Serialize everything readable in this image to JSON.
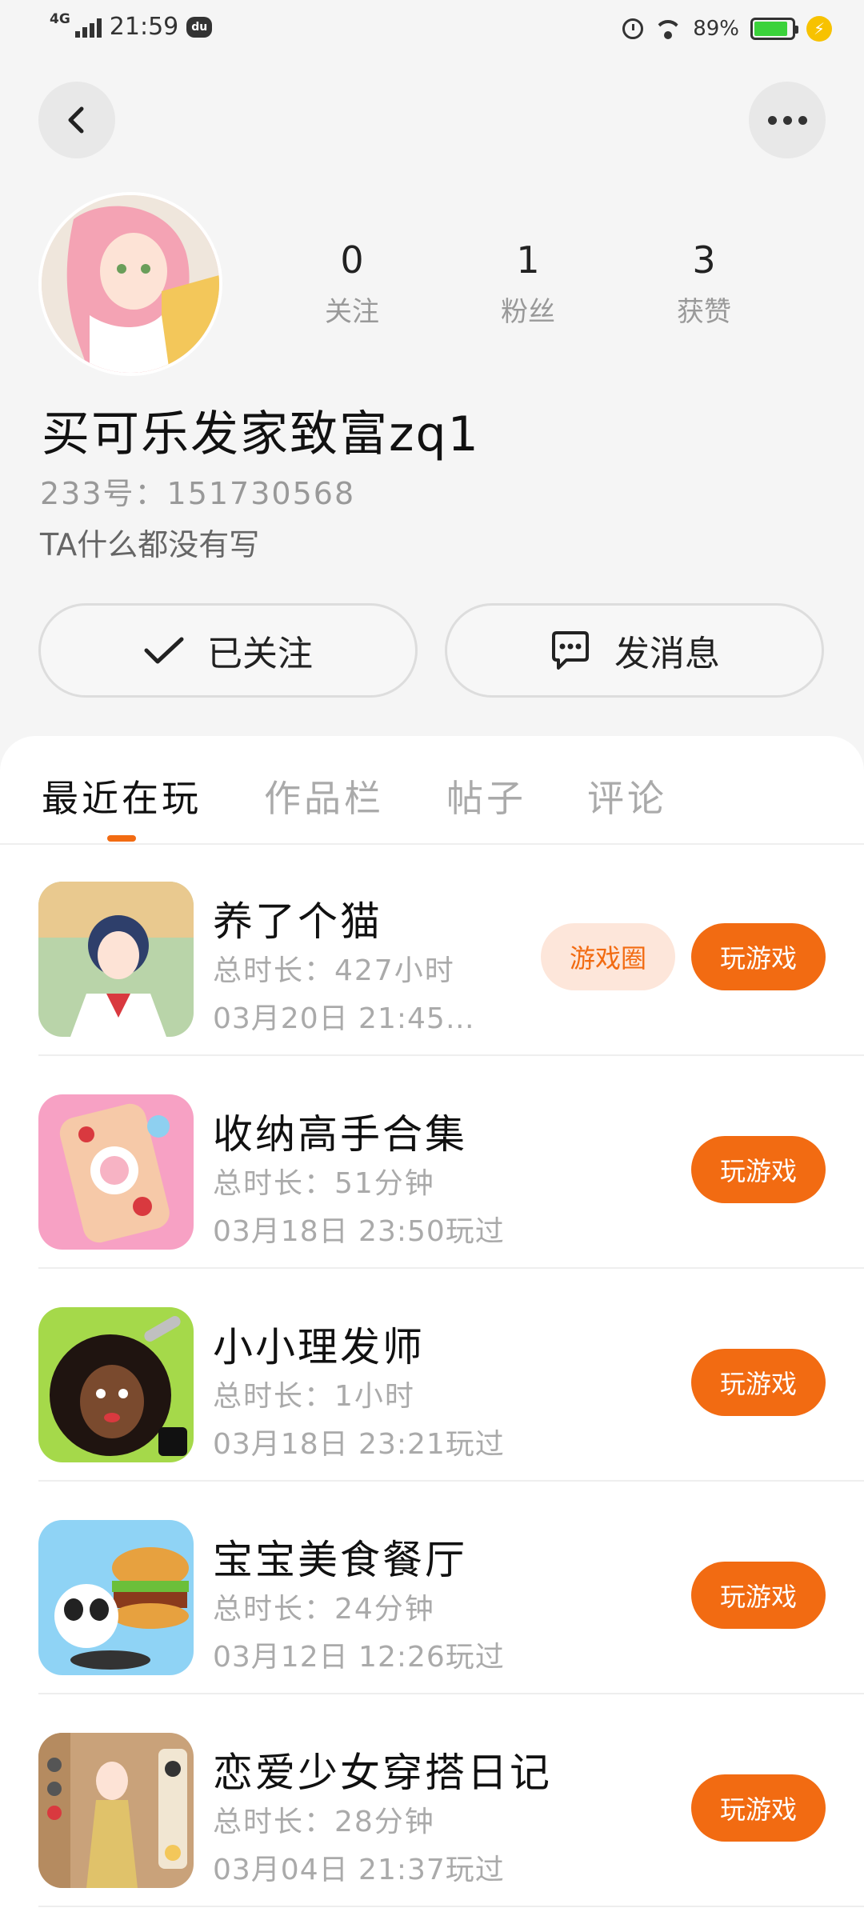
{
  "status_bar": {
    "network": "4G",
    "time": "21:59",
    "app_icon": "du",
    "battery_percent": "89%",
    "battery_level": 0.89,
    "icons": [
      "signal-icon",
      "alarm-icon",
      "wifi-icon",
      "battery-icon",
      "charging-icon"
    ]
  },
  "nav": {
    "back_icon": "chevron-left-icon",
    "more_icon": "more-dots-icon"
  },
  "profile": {
    "stats": [
      {
        "value": "0",
        "label": "关注"
      },
      {
        "value": "1",
        "label": "粉丝"
      },
      {
        "value": "3",
        "label": "获赞"
      }
    ],
    "username": "买可乐发家致富zq1",
    "uid_line": "233号：151730568",
    "bio": "TA什么都没有写"
  },
  "actions": {
    "follow_label": "已关注",
    "message_label": "发消息"
  },
  "tabs": [
    {
      "label": "最近在玩",
      "active": true
    },
    {
      "label": "作品栏",
      "active": false
    },
    {
      "label": "帖子",
      "active": false
    },
    {
      "label": "评论",
      "active": false
    }
  ],
  "accent_color": "#f26b12",
  "games": [
    {
      "title": "养了个猫",
      "duration": "总时长：427小时",
      "date": "03月20日 21:45…",
      "circle_label": "游戏圈",
      "play_label": "玩游戏"
    },
    {
      "title": "收纳高手合集",
      "duration": "总时长：51分钟",
      "date": "03月18日 23:50玩过",
      "play_label": "玩游戏"
    },
    {
      "title": "小小理发师",
      "duration": "总时长：1小时",
      "date": "03月18日 23:21玩过",
      "play_label": "玩游戏"
    },
    {
      "title": "宝宝美食餐厅",
      "duration": "总时长：24分钟",
      "date": "03月12日 12:26玩过",
      "play_label": "玩游戏"
    },
    {
      "title": "恋爱少女穿搭日记",
      "duration": "总时长：28分钟",
      "date": "03月04日 21:37玩过",
      "play_label": "玩游戏"
    }
  ]
}
